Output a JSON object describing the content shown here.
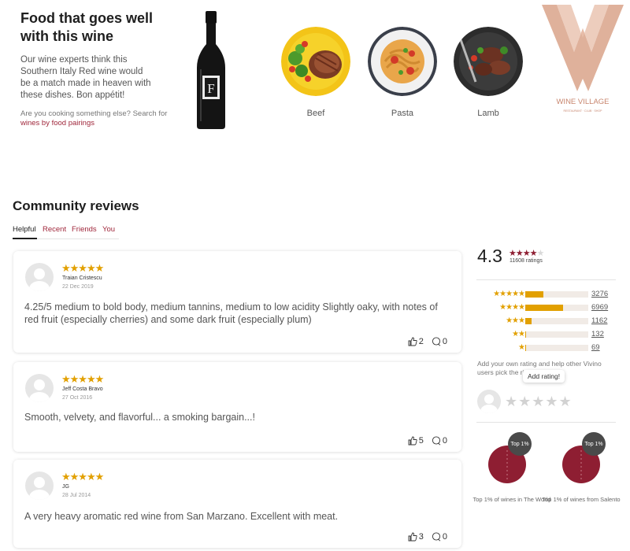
{
  "food": {
    "title": "Food that goes well with this wine",
    "description": "Our wine experts think this Southern Italy Red wine would be a match made in heaven with these dishes. Bon appétit!",
    "cta_prefix": "Are you cooking something else? Search for",
    "cta_link": "wines by food pairings",
    "dishes": [
      {
        "label": "Beef"
      },
      {
        "label": "Pasta"
      },
      {
        "label": "Lamb"
      }
    ],
    "bottle_letter": "F"
  },
  "logo": {
    "name": "WINE VILLAGE",
    "tagline": "RESTAURANT · CLUB · SHOP"
  },
  "reviews": {
    "title": "Community reviews",
    "tabs": [
      "Helpful",
      "Recent",
      "Friends",
      "You"
    ],
    "items": [
      {
        "name": "Traian Cristescu",
        "date": "22 Dec 2019",
        "stars": "★★★★★",
        "text": "4.25/5 medium to bold body, medium tannins, medium to low acidity Slightly oaky, with notes of red fruit (especially cherries) and some dark fruit (especially plum)",
        "likes": "2",
        "comments": "0"
      },
      {
        "name": "Jeff Costa Bravo",
        "date": "27 Oct 2016",
        "stars": "★★★★★",
        "text": "Smooth, velvety, and flavorful... a smoking bargain...!",
        "likes": "5",
        "comments": "0"
      },
      {
        "name": "JG",
        "date": "28 Jul 2014",
        "stars": "★★★★★",
        "text": "A very heavy aromatic red wine from San Marzano. Excellent with meat.",
        "likes": "3",
        "comments": "0"
      }
    ]
  },
  "rating": {
    "average": "4.3",
    "count": "11608 ratings",
    "distribution": [
      {
        "stars": "★★★★★",
        "count": "3276",
        "fraction": 0.29
      },
      {
        "stars": "★★★★",
        "count": "6969",
        "fraction": 0.6
      },
      {
        "stars": "★★★",
        "count": "1162",
        "fraction": 0.1
      },
      {
        "stars": "★★",
        "count": "132",
        "fraction": 0.015
      },
      {
        "stars": "★",
        "count": "69",
        "fraction": 0.01
      }
    ],
    "add_text": "Add your own rating and help other Vivino users pick the right wine!",
    "tooltip": "Add rating!",
    "empty_stars": "★★★★★"
  },
  "badges": [
    {
      "tag": "Top 1%",
      "label": "Top 1% of wines in The World"
    },
    {
      "tag": "Top 1%",
      "label": "Top 1% of wines from Salento"
    }
  ],
  "colors": {
    "accent": "#a0283c",
    "wine": "#8e1e32",
    "star_gold": "#e2a000",
    "logo_rose": "#dca890"
  },
  "icons": [
    "thumbs-up-icon",
    "comment-icon",
    "star-icon",
    "avatar-icon",
    "wine-bottle-icon"
  ]
}
